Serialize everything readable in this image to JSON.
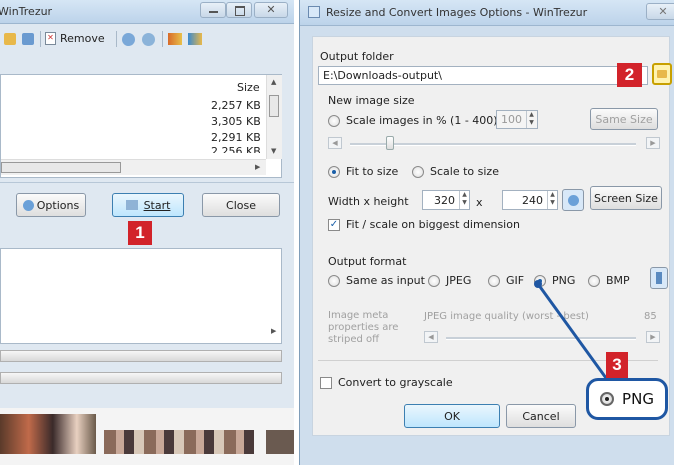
{
  "left_window": {
    "title": "WinTrezur",
    "toolbar": {
      "remove_label": "Remove"
    },
    "list": {
      "size_header": "Size",
      "rows": [
        "2,257 KB",
        "3,305 KB",
        "2,291 KB",
        "2,256 KB"
      ]
    },
    "buttons": {
      "options": "Options",
      "start": "Start",
      "close": "Close"
    }
  },
  "dialog": {
    "title": "Resize and Convert Images Options - WinTrezur",
    "output_folder_label": "Output folder",
    "output_folder_value": "E:\\Downloads-output\\",
    "new_size_label": "New image size",
    "scale_percent_label": "Scale images in % (1 - 400)",
    "scale_percent_value": "100",
    "same_size_button": "Same Size",
    "fit_to_size_label": "Fit to size",
    "scale_to_size_label": "Scale to size",
    "width_height_label": "Width x height",
    "width_value": "320",
    "x_sep": "x",
    "height_value": "240",
    "screen_size_button": "Screen Size",
    "fit_biggest_label": "Fit / scale on biggest dimension",
    "output_format_label": "Output format",
    "formats": {
      "same": "Same as input",
      "jpeg": "JPEG",
      "gif": "GIF",
      "png": "PNG",
      "bmp": "BMP"
    },
    "meta_text": "Image meta properties are striped off",
    "jpeg_quality_label": "JPEG image quality (worst - best)",
    "jpeg_quality_value": "85",
    "grayscale_label": "Convert to grayscale",
    "ok_button": "OK",
    "cancel_button": "Cancel"
  },
  "callouts": {
    "one": "1",
    "two": "2",
    "three": "3",
    "zoom_png": "PNG"
  },
  "colors": {
    "badge": "#d2232a",
    "callout_line": "#1f57a3"
  }
}
